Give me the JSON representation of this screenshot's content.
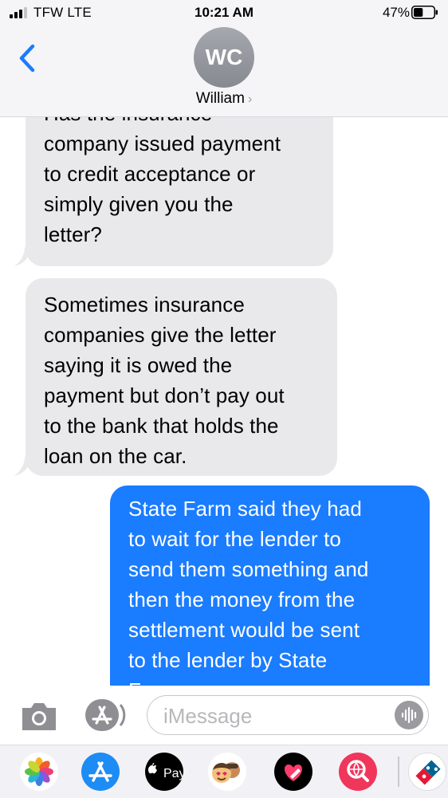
{
  "status_bar": {
    "carrier": "TFW  LTE",
    "time": "10:21 AM",
    "battery_percent": "47%",
    "battery_level": 0.47
  },
  "header": {
    "avatar_initials": "WC",
    "contact_name": "William",
    "chevron": "›"
  },
  "messages": [
    {
      "direction": "incoming",
      "text": "Has the insurance\ncompany issued payment\nto credit acceptance or\nsimply given you the\nletter?"
    },
    {
      "direction": "incoming",
      "text": "Sometimes insurance\ncompanies give the letter\nsaying it is owed the\npayment but don’t pay out\nto the bank that holds the\nloan on the car."
    },
    {
      "direction": "outgoing",
      "text": "State Farm said they had\nto wait for the lender to\nsend them something and\nthen the money from the\nsettlement would be sent\nto the lender by State\nFarm."
    }
  ],
  "input": {
    "placeholder": "iMessage",
    "value": ""
  },
  "drawer": {
    "apps": [
      "photos-icon",
      "app-store-icon",
      "apple-pay-icon",
      "memoji-icon",
      "digital-touch-icon",
      "search-images-icon",
      "dominos-icon"
    ],
    "apple_pay_label": "Pay"
  },
  "colors": {
    "outgoing": "#1a7cff",
    "incoming": "#e9e9eb",
    "accent": "#1a7cff"
  }
}
